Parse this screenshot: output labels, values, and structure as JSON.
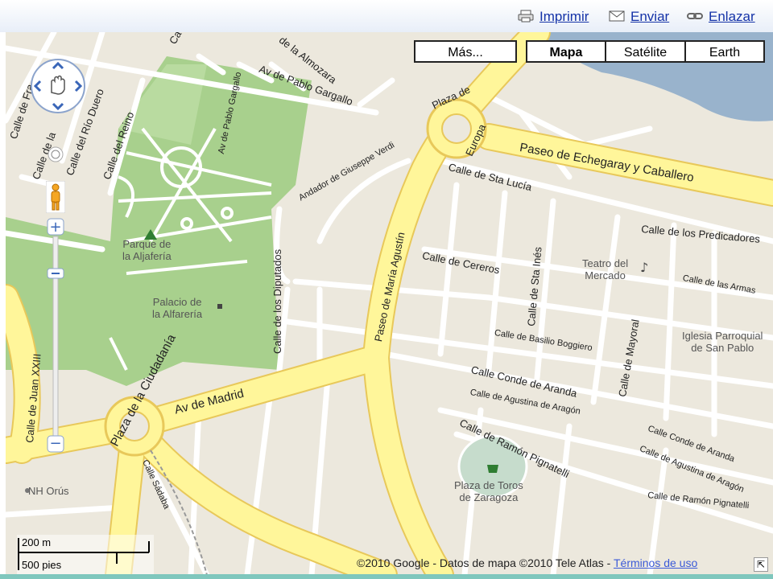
{
  "toolbar": {
    "print_label": "Imprimir",
    "send_label": "Enviar",
    "link_label": "Enlazar"
  },
  "map_types": {
    "more": "Más...",
    "map": "Mapa",
    "satellite": "Satélite",
    "earth": "Earth",
    "selected": "Mapa"
  },
  "streets": {
    "av_pablo_gargallo": "Av de Pablo Gargallo",
    "av_pablo_gargallo_v": "Av de Pablo Gargallo",
    "la_almozara": "de la Almozara",
    "plaza_europa_1": "Plaza de",
    "plaza_europa_2": "Europa",
    "paseo_echegaray": "Paseo de Echegaray y Caballero",
    "calle_sta_lucia": "Calle de Sta Lucía",
    "calle_predicadores": "Calle de los Predicadores",
    "calle_cereros": "Calle de Cereros",
    "calle_sta_ines": "Calle de Sta Inés",
    "calle_armas": "Calle de las Armas",
    "calle_basilio_boggiero": "Calle de Basilio Boggiero",
    "calle_mayoral": "Calle de Mayoral",
    "calle_conde_aranda": "Calle Conde de Aranda",
    "calle_conde_aranda_2": "Calle Conde de Aranda",
    "calle_agustina_aragon": "Calle de Agustina de Aragón",
    "calle_agustina_aragon_2": "Calle de Agustina de Aragón",
    "calle_ramon_pignatelli": "Calle de Ramón Pignatelli",
    "calle_ramon_pignatelli_2": "Calle de Ramón Pignatelli",
    "paseo_maria_agustin": "Paseo de María Agustín",
    "calle_diputados": "Calle de los Diputados",
    "andador_verdi": "Andador de Giuseppe Verdi",
    "av_madrid": "Av de Madrid",
    "plaza_ciudadania": "Plaza de la Ciudadanía",
    "calle_juan_xxiii": "Calle de Juan XXIII",
    "calle_reino": "Calle del Reino",
    "calle_rio_duero": "Calle del Río Duero",
    "calle_de_la": "Calle de la",
    "calle_de_fra": "Calle de Fra",
    "calle_sadaba": "Calle Sádaba",
    "calle_top": "Ca"
  },
  "pois": {
    "parque_aljaferia": "Parque de\nla Aljafería",
    "palacio_alfareria": "Palacio de\nla Alfarería",
    "teatro_mercado": "Teatro del\nMercado",
    "iglesia_san_pablo": "Iglesia Parroquial\nde San Pablo",
    "plaza_toros": "Plaza de Toros\nde Zaragoza",
    "nh_orus": "NH Orús"
  },
  "scale": {
    "metric": "200 m",
    "imperial": "500 pies"
  },
  "footer": {
    "copyright": "©2010 Google - Datos de mapa ©2010 Tele Atlas -",
    "terms": "Términos de uso"
  },
  "colors": {
    "major_road": "#fff69a",
    "road_border": "#e8c85a",
    "park": "#a8d08d",
    "water": "#99b3cc",
    "land": "#ece8dd",
    "link": "#1533a8"
  }
}
